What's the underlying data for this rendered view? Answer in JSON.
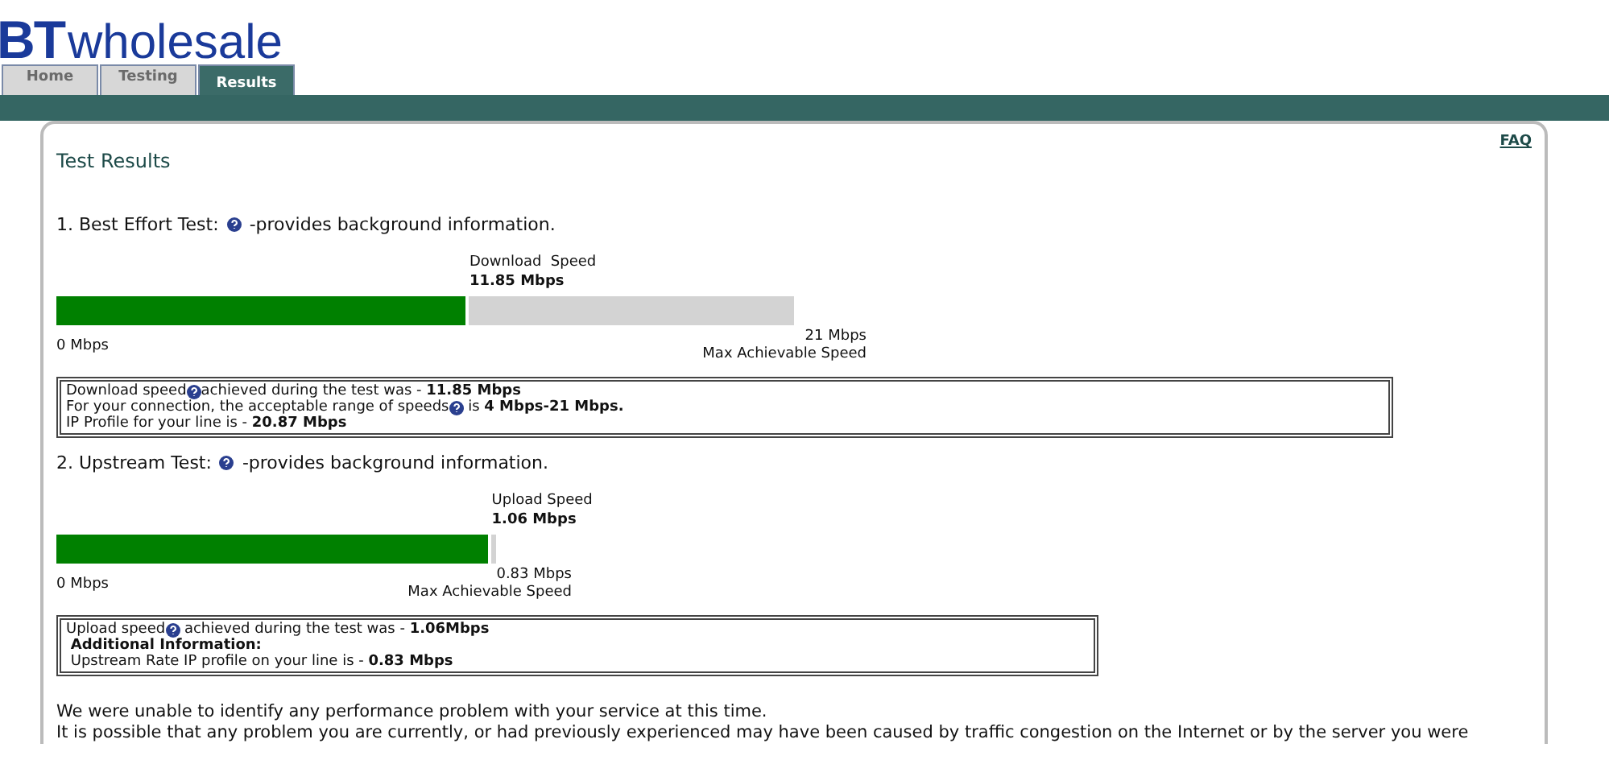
{
  "logo": {
    "brand": "BT",
    "word": "wholesale"
  },
  "tabs": [
    {
      "label": "Home",
      "selected": false
    },
    {
      "label": "Testing",
      "selected": false
    },
    {
      "label": "Results",
      "selected": true
    }
  ],
  "faq_link": "FAQ",
  "title": "Test Results",
  "tests": [
    {
      "heading": "1. Best Effort Test:",
      "note": "-provides background information.",
      "speed_label": "Download  Speed",
      "speed_value": "11.85 Mbps",
      "level": 0.56,
      "min_label": "0 Mbps",
      "max_value": "21 Mbps",
      "max_label": "Max Achievable Speed",
      "info": [
        {
          "before": "Download speed",
          "after": "achieved during the test was - **11.85 Mbps**"
        },
        {
          "before": "For your connection, the acceptable range of speeds",
          "after": " is **4 Mbps-21 Mbps.**"
        },
        {
          "text": "IP Profile for your line is - **20.87 Mbps**"
        }
      ]
    },
    {
      "heading": "2. Upstream Test:",
      "note": "-provides background information.",
      "speed_label": "Upload Speed",
      "speed_value": "1.06 Mbps",
      "level": 0.99,
      "min_label": "0 Mbps",
      "max_value": "0.83 Mbps",
      "max_label": "Max Achievable Speed",
      "info": [
        {
          "before": "Upload speed",
          "after": " achieved during the test was - **1.06Mbps**"
        },
        {
          "text": " **Additional Information:**"
        },
        {
          "text": " Upstream Rate IP profile on your line is - **0.83 Mbps**"
        }
      ]
    }
  ],
  "conclusion": [
    "We were unable to identify any performance problem with your service at this time.",
    "It is possible that any problem you are currently, or had previously experienced may have been caused by traffic congestion on the Internet or by the server you were"
  ]
}
